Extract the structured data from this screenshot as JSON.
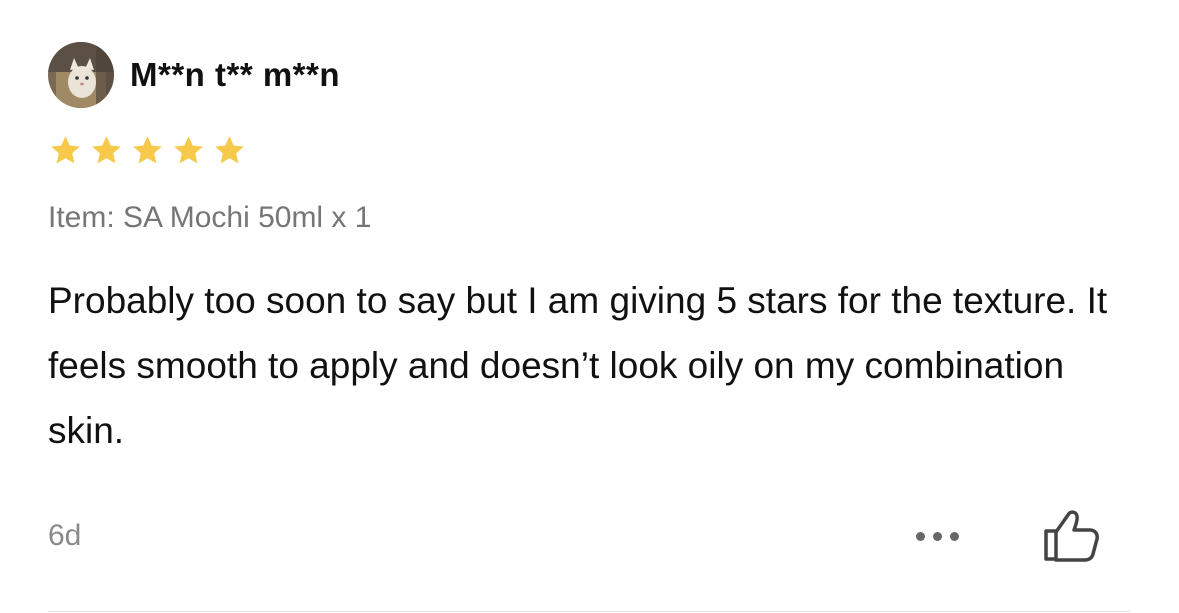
{
  "review": {
    "username": "M**n t** m**n",
    "rating": 5,
    "rating_max": 5,
    "star_color": "#F6C94A",
    "item_label": "Item: SA Mochi 50ml x 1",
    "text": "Probably too soon to say but I am giving 5 stars for the texture. It feels smooth to apply and doesn’t look oily on my combination skin.",
    "timestamp": "6d",
    "more_icon": "ellipsis-icon",
    "like_icon": "thumbs-up-icon"
  }
}
